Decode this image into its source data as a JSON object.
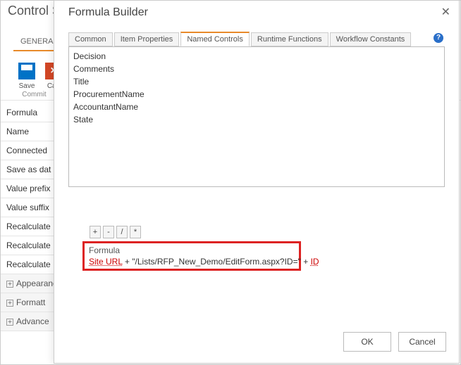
{
  "bg": {
    "title": "Control Se",
    "tab_general": "GENERAL",
    "ribbon_save": "Save",
    "ribbon_cancel": "Can",
    "ribbon_group": "Commit",
    "rows": [
      "Formula",
      "Name",
      "Connected",
      "Save as dat",
      "Value prefix",
      "Value suffix",
      "Recalculate",
      "Recalculate",
      "Recalculate"
    ],
    "group_appearance": "Appearanc",
    "group_formatting": "Formatt",
    "group_advanced": "Advance"
  },
  "modal": {
    "title": "Formula Builder",
    "tabs": {
      "common": "Common",
      "item_properties": "Item Properties",
      "named_controls": "Named Controls",
      "runtime_functions": "Runtime Functions",
      "workflow_constants": "Workflow Constants"
    },
    "active_tab": "named_controls",
    "list_items": [
      "Decision",
      "Comments",
      "Title",
      "ProcurementName",
      "AccountantName",
      "State"
    ],
    "ops": {
      "plus": "+",
      "minus": "-",
      "div": "/",
      "mul": "*"
    },
    "formula_label": "Formula",
    "formula_parts": {
      "token_site": "Site URL",
      "plus1": " + ",
      "literal": "\"/Lists/RFP_New_Demo/EditForm.aspx?ID=\"",
      "plus2": " + ",
      "token_id": "ID"
    },
    "help": "?",
    "ok": "OK",
    "cancel": "Cancel"
  }
}
